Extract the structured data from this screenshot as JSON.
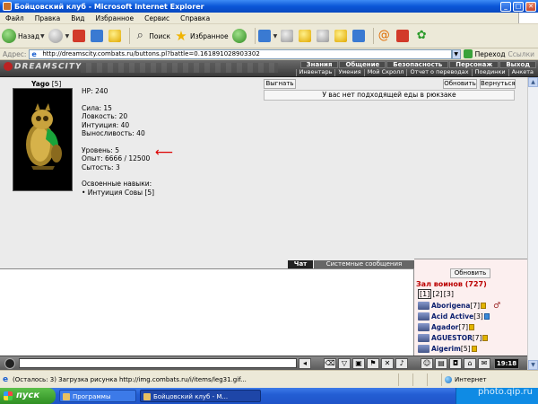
{
  "window": {
    "title": "Бойцовский клуб - Microsoft Internet Explorer",
    "min": "_",
    "max": "□",
    "close": "✕"
  },
  "menu": [
    "Файл",
    "Правка",
    "Вид",
    "Избранное",
    "Сервис",
    "Справка"
  ],
  "toolbar": {
    "back": "Назад",
    "search": "Поиск",
    "favorites": "Избранное"
  },
  "address": {
    "label": "Адрес:",
    "url": "http://dreamscity.combats.ru/buttons.pl?battle=0.161891028903302",
    "go": "Переход",
    "links": "Ссылки"
  },
  "game_header": {
    "logo": "DREAMSCITY",
    "nav": [
      "Знания",
      "Общение",
      "Безопасность",
      "Персонаж",
      "Выход"
    ],
    "subnav": [
      "Инвентарь",
      "Умения",
      "Мой Скролл",
      "Отчет о переводах",
      "Поединки",
      "Анкета"
    ]
  },
  "character": {
    "name": "Yago",
    "level_tag": "[5]",
    "hp": "HP: 240",
    "strength": "Сила: 15",
    "agility": "Ловкость: 20",
    "intuition": "Интуиция: 40",
    "endurance": "Выносливость: 40",
    "level": "Уровень: 5",
    "experience": "Опыт: 6666 / 12500",
    "satiety": "Сытость: 3",
    "skills_title": "Освоенные навыки:",
    "skill_1": "• Интуиция Совы [5]"
  },
  "actions": {
    "expel": "Выгнать",
    "refresh": "Обновить",
    "return": "Вернуться",
    "food_message": "У вас нет подходящей еды в рюкзаке"
  },
  "chat": {
    "tab_chat": "Чат",
    "tab_system": "Системные сообщения"
  },
  "side": {
    "refresh": "Обновить",
    "hall_title": "Зал воинов (727)",
    "pages": [
      "[1]",
      "[2]",
      "[3]"
    ],
    "players": [
      {
        "name": "Aborigena",
        "level": "[7]"
      },
      {
        "name": "Acid Active",
        "level": "[3]"
      },
      {
        "name": "Agador",
        "level": "[7]"
      },
      {
        "name": "AGUESTOR",
        "level": "[7]"
      },
      {
        "name": "Aigerim",
        "level": "[5]"
      }
    ]
  },
  "inputbar": {
    "clock": "19:18"
  },
  "status": {
    "text": "(Осталось: 3) Загрузка рисунка http://img.combats.ru/i/items/leg31.gif...",
    "zone": "Интернет"
  },
  "taskbar": {
    "start": "пуск",
    "task1": "Программы",
    "task2": "Бойцовский клуб - M..."
  },
  "watermark": "photo.qip.ru"
}
